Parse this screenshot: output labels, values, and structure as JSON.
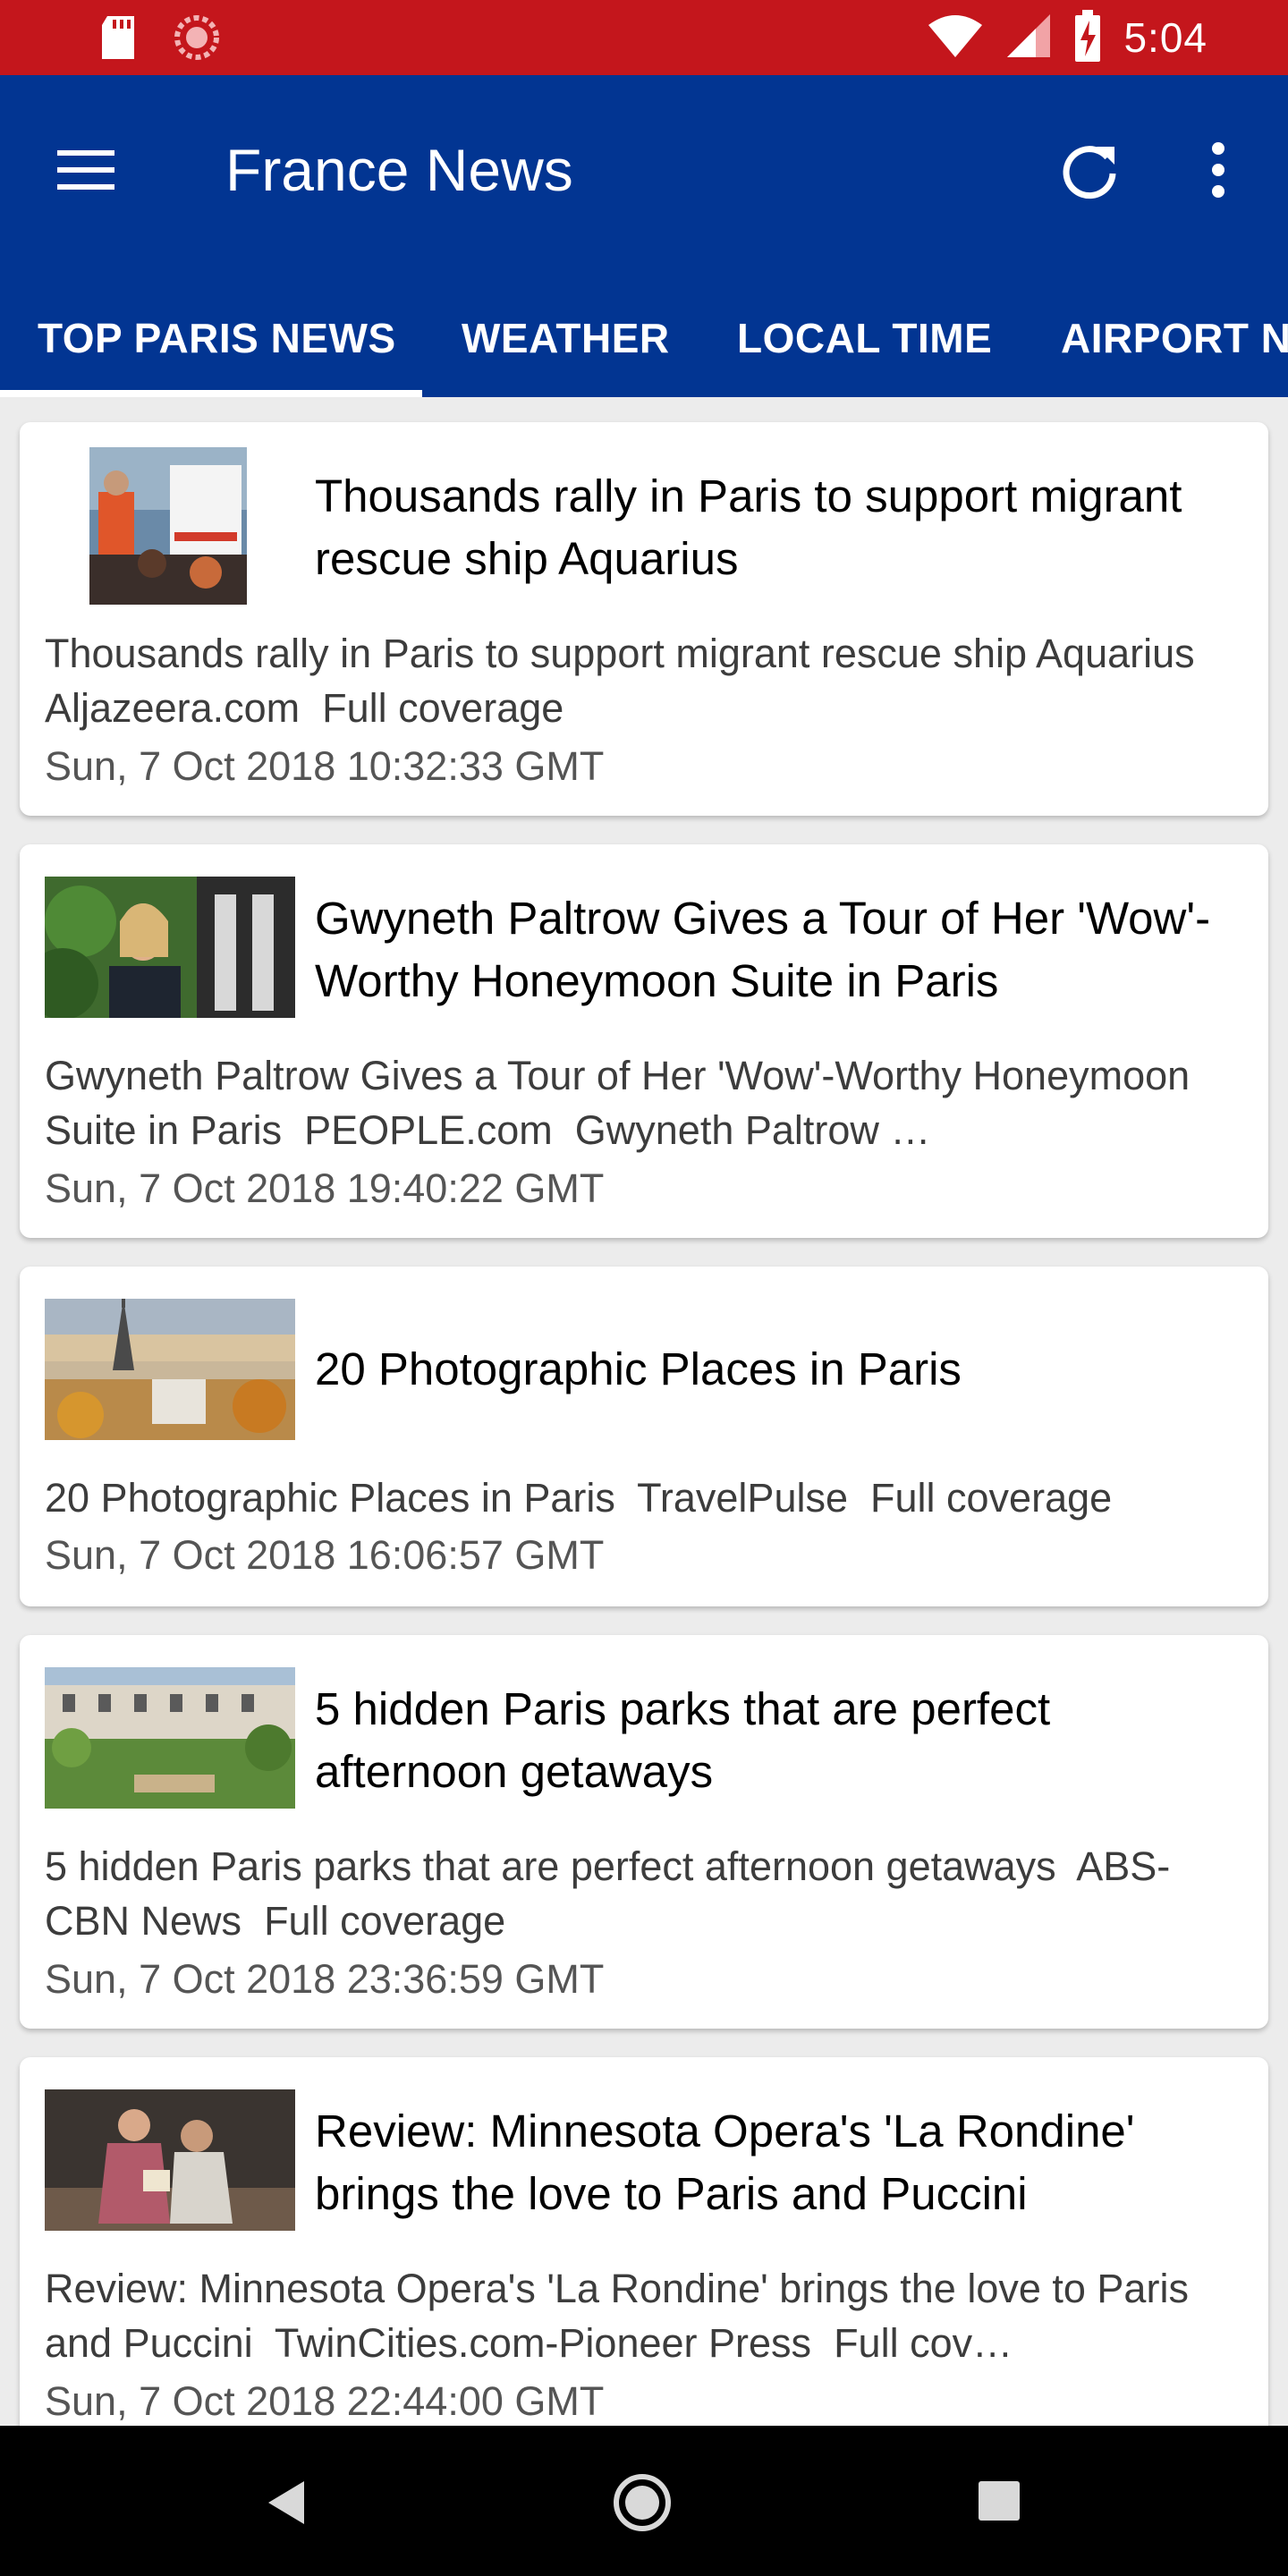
{
  "status_bar": {
    "time": "5:04",
    "icons": [
      "sd-card-icon",
      "sync-icon",
      "wifi-icon",
      "cell-signal-icon",
      "battery-charging-icon"
    ]
  },
  "app_bar": {
    "title": "France News",
    "menu_icon": "hamburger-menu-icon",
    "refresh_icon": "refresh-icon",
    "more_icon": "more-vert-icon",
    "color": "#023592"
  },
  "tabs": [
    {
      "label": "TOP PARIS NEWS",
      "selected": true
    },
    {
      "label": "WEATHER",
      "selected": false
    },
    {
      "label": "LOCAL TIME",
      "selected": false
    },
    {
      "label": "AIRPORT NEWS",
      "selected": false
    }
  ],
  "articles": [
    {
      "headline": "Thousands rally in Paris to support migrant rescue ship Aquarius",
      "summary": "Thousands rally in Paris to support migrant rescue ship Aquarius",
      "source": "Aljazeera.com",
      "coverage": "Full coverage",
      "date": "Sun, 7 Oct 2018 10:32:33 GMT",
      "image": "rally-photo"
    },
    {
      "headline": "Gwyneth Paltrow Gives a Tour of Her 'Wow'-Worthy Honeymoon Suite in Paris",
      "summary": "Gwyneth Paltrow Gives a Tour of Her 'Wow'-Worthy Honeymoon Suite in Paris",
      "source": "PEOPLE.com",
      "coverage": "Gwyneth Paltrow …",
      "date": "Sun, 7 Oct 2018 19:40:22 GMT",
      "image": "portrait-photo"
    },
    {
      "headline": "20 Photographic Places in Paris",
      "summary": "20 Photographic Places in Paris",
      "source": "TravelPulse",
      "coverage": "Full coverage",
      "date": "Sun, 7 Oct 2018 16:06:57 GMT",
      "image": "eiffel-tower-photo"
    },
    {
      "headline": "5 hidden Paris parks that are perfect afternoon getaways",
      "summary": "5 hidden Paris parks that are perfect afternoon getaways",
      "source": "ABS-CBN News",
      "coverage": "Full coverage",
      "date": "Sun, 7 Oct 2018 23:36:59 GMT",
      "image": "park-photo"
    },
    {
      "headline": "Review: Minnesota Opera's 'La Rondine' brings the love to Paris and Puccini",
      "summary": "Review: Minnesota Opera's 'La Rondine' brings the love to Paris and Puccini",
      "source": "TwinCities.com-Pioneer Press",
      "coverage": "Full cov…",
      "date": "Sun, 7 Oct 2018 22:44:00 GMT",
      "image": "opera-photo"
    }
  ],
  "nav_bar": {
    "icons": [
      "back-icon",
      "home-icon",
      "recent-apps-icon"
    ]
  }
}
